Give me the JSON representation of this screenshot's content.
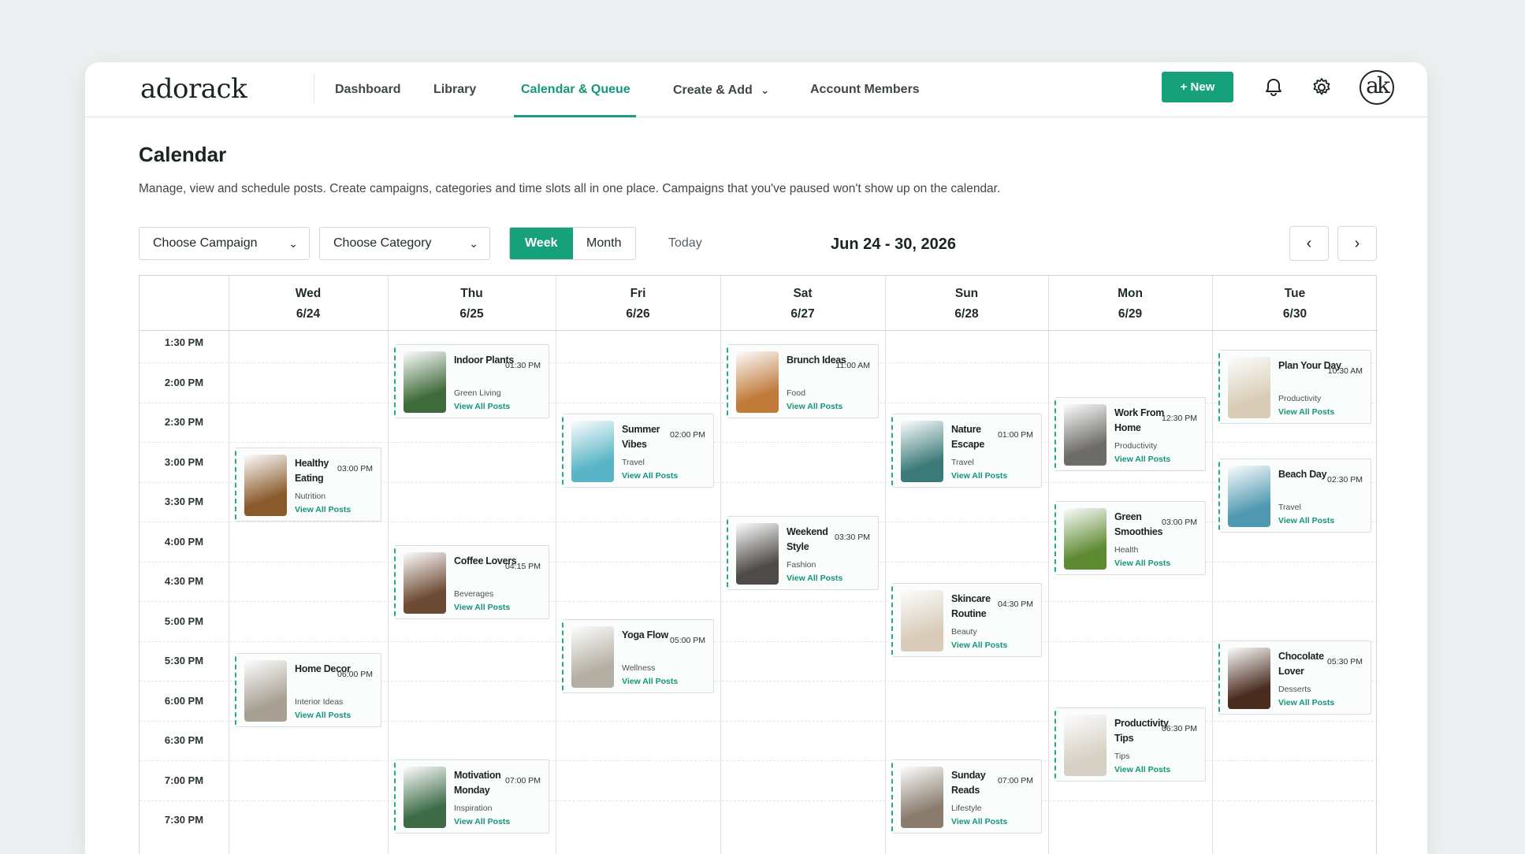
{
  "brand": {
    "logo_text": "adorack",
    "avatar_text": "ak"
  },
  "nav": {
    "items": [
      {
        "label": "Dashboard",
        "active": false
      },
      {
        "label": "Library",
        "active": false
      },
      {
        "label": "Calendar & Queue",
        "active": true
      },
      {
        "label": "Create & Add",
        "active": false,
        "has_dropdown": true
      },
      {
        "label": "Account Members",
        "active": false
      }
    ],
    "new_button": "+ New",
    "icons": [
      "bell-icon",
      "gear-icon"
    ]
  },
  "header": {
    "title": "Calendar",
    "description": "Manage, view and schedule posts. Create campaigns, categories and time slots all in one place.  Campaigns that you've paused won't show up on the calendar."
  },
  "controls": {
    "campaign_select": "Choose Campaign",
    "category_select": "Choose Category",
    "view_toggle": [
      {
        "label": "Week",
        "active": true
      },
      {
        "label": "Month",
        "active": false
      }
    ],
    "today": "Today",
    "range": "Jun 24 - 30, 2026",
    "prev": "‹",
    "next": "›"
  },
  "calendar": {
    "days": [
      {
        "name": "Wed",
        "date": "6/24"
      },
      {
        "name": "Thu",
        "date": "6/25"
      },
      {
        "name": "Fri",
        "date": "6/26"
      },
      {
        "name": "Sat",
        "date": "6/27"
      },
      {
        "name": "Sun",
        "date": "6/28"
      },
      {
        "name": "Mon",
        "date": "6/29"
      },
      {
        "name": "Tue",
        "date": "6/30"
      }
    ],
    "times": [
      "1:30 PM",
      "2:00 PM",
      "2:30 PM",
      "3:00 PM",
      "3:30 PM",
      "4:00 PM",
      "4:30 PM",
      "5:00 PM",
      "5:30 PM",
      "6:00 PM",
      "6:30 PM",
      "7:00 PM",
      "7:30 PM"
    ],
    "posts": [
      {
        "day": 0,
        "title": "Healthy Eating",
        "time": "03:00 PM",
        "category": "Nutrition",
        "link": "View All Posts",
        "thumb": "salad-thumbnail",
        "start": 2.96,
        "color": "#8a5a2b"
      },
      {
        "day": 0,
        "title": "Home Decor",
        "time": "06:00 PM",
        "category": "Interior Ideas",
        "link": "View All Posts",
        "thumb": "livingroom-thumbnail",
        "start": 8.12,
        "color": "#a79f92"
      },
      {
        "day": 1,
        "title": "Indoor Plants",
        "time": "01:30 PM",
        "category": "Green Living",
        "link": "View All Posts",
        "thumb": "plant-thumbnail",
        "start": 0.36,
        "color": "#3f6b3a"
      },
      {
        "day": 1,
        "title": "Coffee Lovers",
        "time": "04:15 PM",
        "category": "Beverages",
        "link": "View All Posts",
        "thumb": "coffee-thumbnail",
        "start": 5.4,
        "color": "#6d4a33"
      },
      {
        "day": 1,
        "title": "Motivation Monday",
        "time": "07:00 PM",
        "category": "Inspiration",
        "link": "View All Posts",
        "thumb": "quote-thumbnail",
        "start": 10.8,
        "color": "#3c6b46"
      },
      {
        "day": 2,
        "title": "Summer Vibes",
        "time": "02:00 PM",
        "category": "Travel",
        "link": "View All Posts",
        "thumb": "beach-thumbnail",
        "start": 2.1,
        "color": "#58b4c6"
      },
      {
        "day": 2,
        "title": "Yoga Flow",
        "time": "05:00 PM",
        "category": "Wellness",
        "link": "View All Posts",
        "thumb": "yoga-thumbnail",
        "start": 7.26,
        "color": "#b4aea2"
      },
      {
        "day": 3,
        "title": "Brunch Ideas",
        "time": "11:00 AM",
        "category": "Food",
        "link": "View All Posts",
        "thumb": "pancake-thumbnail",
        "start": 0.36,
        "color": "#c07a3a"
      },
      {
        "day": 3,
        "title": "Weekend Style",
        "time": "03:30 PM",
        "category": "Fashion",
        "link": "View All Posts",
        "thumb": "fashion-thumbnail",
        "start": 4.68,
        "color": "#4e4a47"
      },
      {
        "day": 4,
        "title": "Nature Escape",
        "time": "01:00 PM",
        "category": "Travel",
        "link": "View All Posts",
        "thumb": "lake-thumbnail",
        "start": 2.1,
        "color": "#3b7a78"
      },
      {
        "day": 4,
        "title": "Skincare Routine",
        "time": "04:30 PM",
        "category": "Beauty",
        "link": "View All Posts",
        "thumb": "skincare-thumbnail",
        "start": 6.36,
        "color": "#d9cbb8"
      },
      {
        "day": 4,
        "title": "Sunday Reads",
        "time": "07:00 PM",
        "category": "Lifestyle",
        "link": "View All Posts",
        "thumb": "reading-thumbnail",
        "start": 10.8,
        "color": "#8a7b6d"
      },
      {
        "day": 5,
        "title": "Work From Home",
        "time": "12:30 PM",
        "category": "Productivity",
        "link": "View All Posts",
        "thumb": "laptop-thumbnail",
        "start": 1.68,
        "color": "#6e6c68"
      },
      {
        "day": 5,
        "title": "Green Smoothies",
        "time": "03:00 PM",
        "category": "Health",
        "link": "View All Posts",
        "thumb": "smoothie-thumbnail",
        "start": 4.3,
        "color": "#5e8a32"
      },
      {
        "day": 5,
        "title": "Productivity Tips",
        "time": "06:30 PM",
        "category": "Tips",
        "link": "View All Posts",
        "thumb": "notebook-thumbnail",
        "start": 9.48,
        "color": "#d6cfc3"
      },
      {
        "day": 6,
        "title": "Plan Your Day",
        "time": "10:30 AM",
        "category": "Productivity",
        "link": "View All Posts",
        "thumb": "planner-thumbnail",
        "start": 0.5,
        "color": "#d8ccb6"
      },
      {
        "day": 6,
        "title": "Beach Day",
        "time": "02:30 PM",
        "category": "Travel",
        "link": "View All Posts",
        "thumb": "palm-thumbnail",
        "start": 3.22,
        "color": "#4f98b0"
      },
      {
        "day": 6,
        "title": "Chocolate Lover",
        "time": "05:30 PM",
        "category": "Desserts",
        "link": "View All Posts",
        "thumb": "cake-thumbnail",
        "start": 7.8,
        "color": "#4a2c1f"
      }
    ]
  }
}
